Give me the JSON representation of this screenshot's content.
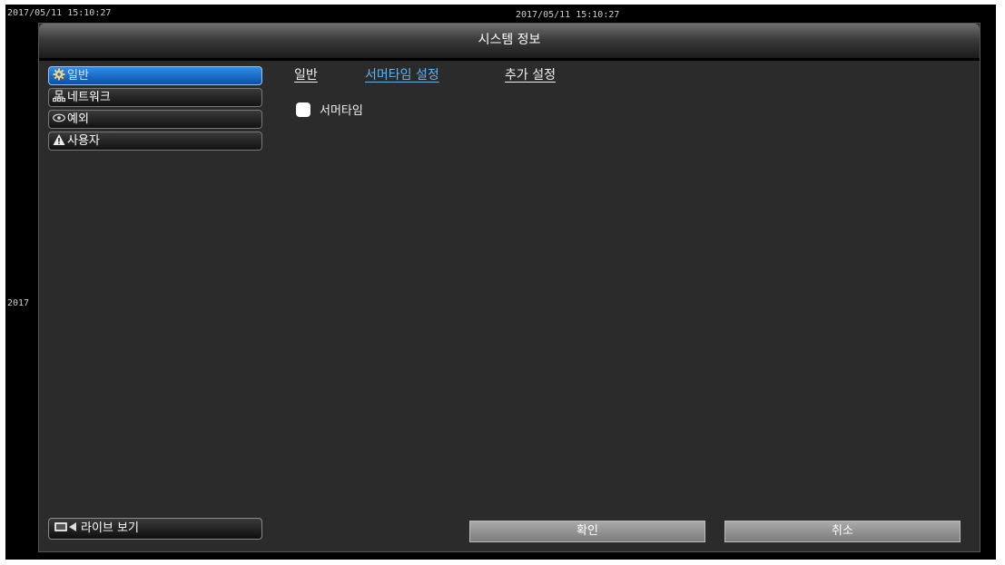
{
  "timestamps": {
    "top_left": "2017/05/11 15:10:27",
    "top_center": "2017/05/11 15:10:27",
    "side": "2017"
  },
  "window": {
    "title": "시스템 정보"
  },
  "sidebar": {
    "items": [
      {
        "label": "일반",
        "icon": "gear-icon",
        "active": true
      },
      {
        "label": "네트워크",
        "icon": "network-icon",
        "active": false
      },
      {
        "label": "예외",
        "icon": "eye-icon",
        "active": false
      },
      {
        "label": "사용자",
        "icon": "warning-icon",
        "active": false
      }
    ],
    "live_view_label": "라이브 보기"
  },
  "tabs": [
    {
      "label": "일반",
      "active": false
    },
    {
      "label": "서머타임 설정",
      "active": true
    },
    {
      "label": "추가 설정",
      "active": false
    }
  ],
  "dst": {
    "checkbox_label": "서머타임",
    "checked": false
  },
  "buttons": {
    "ok_label": "확인",
    "cancel_label": "취소"
  },
  "colors": {
    "accent": "#5eb3f5",
    "active_item": "#1a6fd1",
    "panel_bg": "#2b2b2b"
  }
}
